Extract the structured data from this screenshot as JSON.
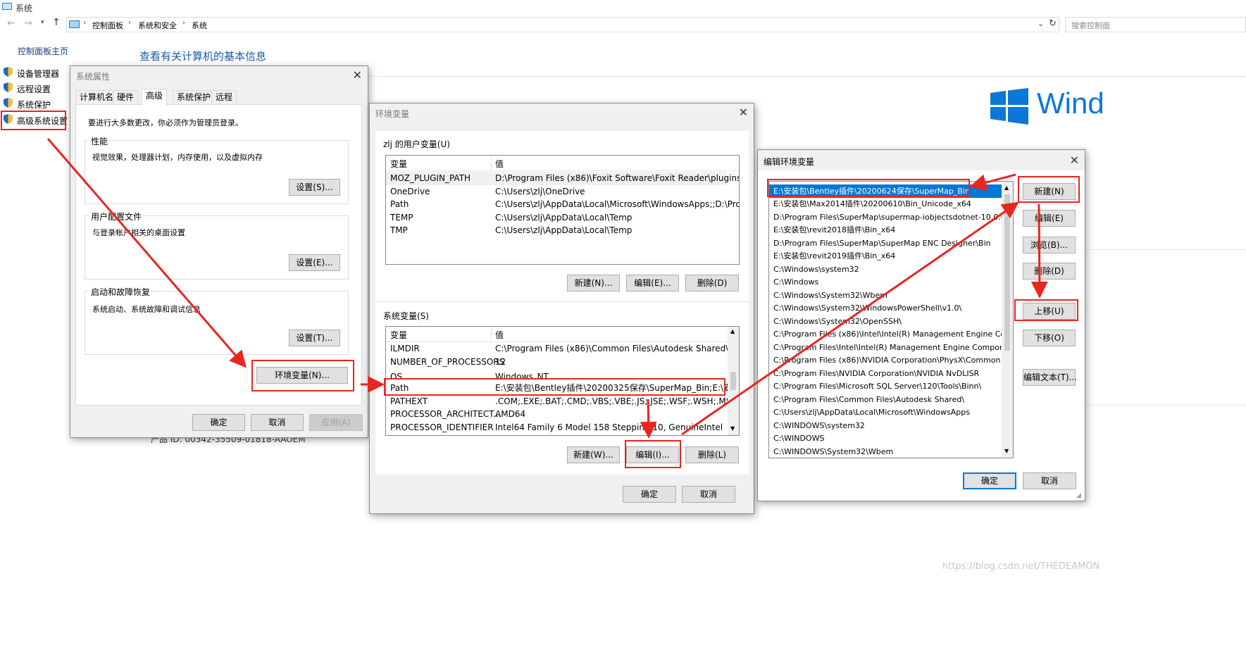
{
  "window": {
    "title": "系统",
    "breadcrumb": [
      "控制面板",
      "系统和安全",
      "系统"
    ],
    "search_placeholder": "搜索控制面"
  },
  "sidebar": {
    "home": "控制面板主页",
    "items": [
      "设备管理器",
      "远程设置",
      "系统保护",
      "高级系统设置"
    ]
  },
  "main": {
    "heading": "查看有关计算机的基本信息",
    "product_id": "产品 ID: 00342-35509-01818-AAOEM",
    "logo_text": "Wind"
  },
  "sysprops": {
    "title": "系统属性",
    "tabs": [
      "计算机名",
      "硬件",
      "高级",
      "系统保护",
      "远程"
    ],
    "admin_note": "要进行大多数更改，你必须作为管理员登录。",
    "perf_label": "性能",
    "perf_desc": "视觉效果，处理器计划，内存使用，以及虚拟内存",
    "perf_btn": "设置(S)...",
    "profile_label": "用户配置文件",
    "profile_desc": "与登录帐户相关的桌面设置",
    "profile_btn": "设置(E)...",
    "startup_label": "启动和故障恢复",
    "startup_desc": "系统启动、系统故障和调试信息",
    "startup_btn": "设置(T)...",
    "env_btn": "环境变量(N)...",
    "ok": "确定",
    "cancel": "取消",
    "apply": "应用(A)"
  },
  "envvars": {
    "title": "环境变量",
    "user_label": "zlj 的用户变量(U)",
    "col_var": "变量",
    "col_val": "值",
    "user_vars": [
      {
        "name": "MOZ_PLUGIN_PATH",
        "value": "D:\\Program Files (x86)\\Foxit Software\\Foxit Reader\\plugins\\"
      },
      {
        "name": "OneDrive",
        "value": "C:\\Users\\zlj\\OneDrive"
      },
      {
        "name": "Path",
        "value": "C:\\Users\\zlj\\AppData\\Local\\Microsoft\\WindowsApps;;D:\\Prog..."
      },
      {
        "name": "TEMP",
        "value": "C:\\Users\\zlj\\AppData\\Local\\Temp"
      },
      {
        "name": "TMP",
        "value": "C:\\Users\\zlj\\AppData\\Local\\Temp"
      }
    ],
    "user_new": "新建(N)...",
    "user_edit": "编辑(E)...",
    "user_delete": "删除(D)",
    "sys_label": "系统变量(S)",
    "sys_vars": [
      {
        "name": "ILMDIR",
        "value": "C:\\Program Files (x86)\\Common Files\\Autodesk Shared\\Mate..."
      },
      {
        "name": "NUMBER_OF_PROCESSORS",
        "value": "12"
      },
      {
        "name": "OS",
        "value": "Windows_NT"
      },
      {
        "name": "Path",
        "value": "E:\\安装包\\Bentley插件\\20200325保存\\SuperMap_Bin;E:\\安装包\\..."
      },
      {
        "name": "PATHEXT",
        "value": ".COM;.EXE;.BAT;.CMD;.VBS;.VBE;.JS;.JSE;.WSF;.WSH;.MSC"
      },
      {
        "name": "PROCESSOR_ARCHITECT...",
        "value": "AMD64"
      },
      {
        "name": "PROCESSOR_IDENTIFIER",
        "value": "Intel64 Family 6 Model 158 Stepping 10, GenuineIntel"
      }
    ],
    "sys_new": "新建(W)...",
    "sys_edit": "编辑(I)...",
    "sys_delete": "删除(L)",
    "ok": "确定",
    "cancel": "取消"
  },
  "editenv": {
    "title": "编辑环境变量",
    "paths": [
      "E:\\安装包\\Bentley插件\\20200624保存\\SuperMap_Bin",
      "E:\\安装包\\Max2014插件\\20200610\\Bin_Unicode_x64",
      "D:\\Program Files\\SuperMap\\supermap-iobjectsdotnet-10.0.0...",
      "E:\\安装包\\revit2018插件\\Bin_x64",
      "D:\\Program Files\\SuperMap\\SuperMap ENC Designer\\Bin",
      "E:\\安装包\\revit2019插件\\Bin_x64",
      "C:\\Windows\\system32",
      "C:\\Windows",
      "C:\\Windows\\System32\\Wbem",
      "C:\\Windows\\System32\\WindowsPowerShell\\v1.0\\",
      "C:\\Windows\\System32\\OpenSSH\\",
      "C:\\Program Files (x86)\\Intel\\Intel(R) Management Engine Co...",
      "C:\\Program Files\\Intel\\Intel(R) Management Engine Compon...",
      "C:\\Program Files (x86)\\NVIDIA Corporation\\PhysX\\Common",
      "C:\\Program Files\\NVIDIA Corporation\\NVIDIA NvDLISR",
      "C:\\Program Files\\Microsoft SQL Server\\120\\Tools\\Binn\\",
      "C:\\Program Files\\Common Files\\Autodesk Shared\\",
      "C:\\Users\\zlj\\AppData\\Local\\Microsoft\\WindowsApps",
      "C:\\WINDOWS\\system32",
      "C:\\WINDOWS",
      "C:\\WINDOWS\\System32\\Wbem"
    ],
    "btn_new": "新建(N)",
    "btn_edit": "编辑(E)",
    "btn_browse": "浏览(B)...",
    "btn_delete": "删除(D)",
    "btn_up": "上移(U)",
    "btn_down": "下移(O)",
    "btn_edittext": "编辑文本(T)...",
    "ok": "确定",
    "cancel": "取消"
  },
  "watermark": "https://blog.csdn.net/THEDEAMON",
  "colors": {
    "annotation_red": "#e8261f",
    "selection_blue": "#0078d7",
    "link_blue": "#1a5aa6",
    "windows_blue": "#0a78d7"
  }
}
